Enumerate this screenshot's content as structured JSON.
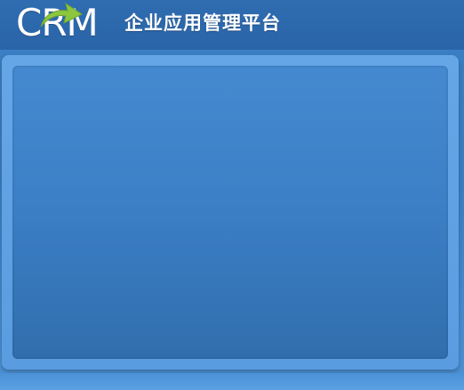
{
  "header": {
    "logo_text": "CRM",
    "subtitle": "企业应用管理平台"
  },
  "colors": {
    "header_background": "#2b66aa",
    "panel_background": "#5f9fe2",
    "panel_inner": "#3b7fc6",
    "logo_arrow": "#8cc63f"
  },
  "icons": {
    "logo_arrow": "curved-arrow-icon"
  }
}
